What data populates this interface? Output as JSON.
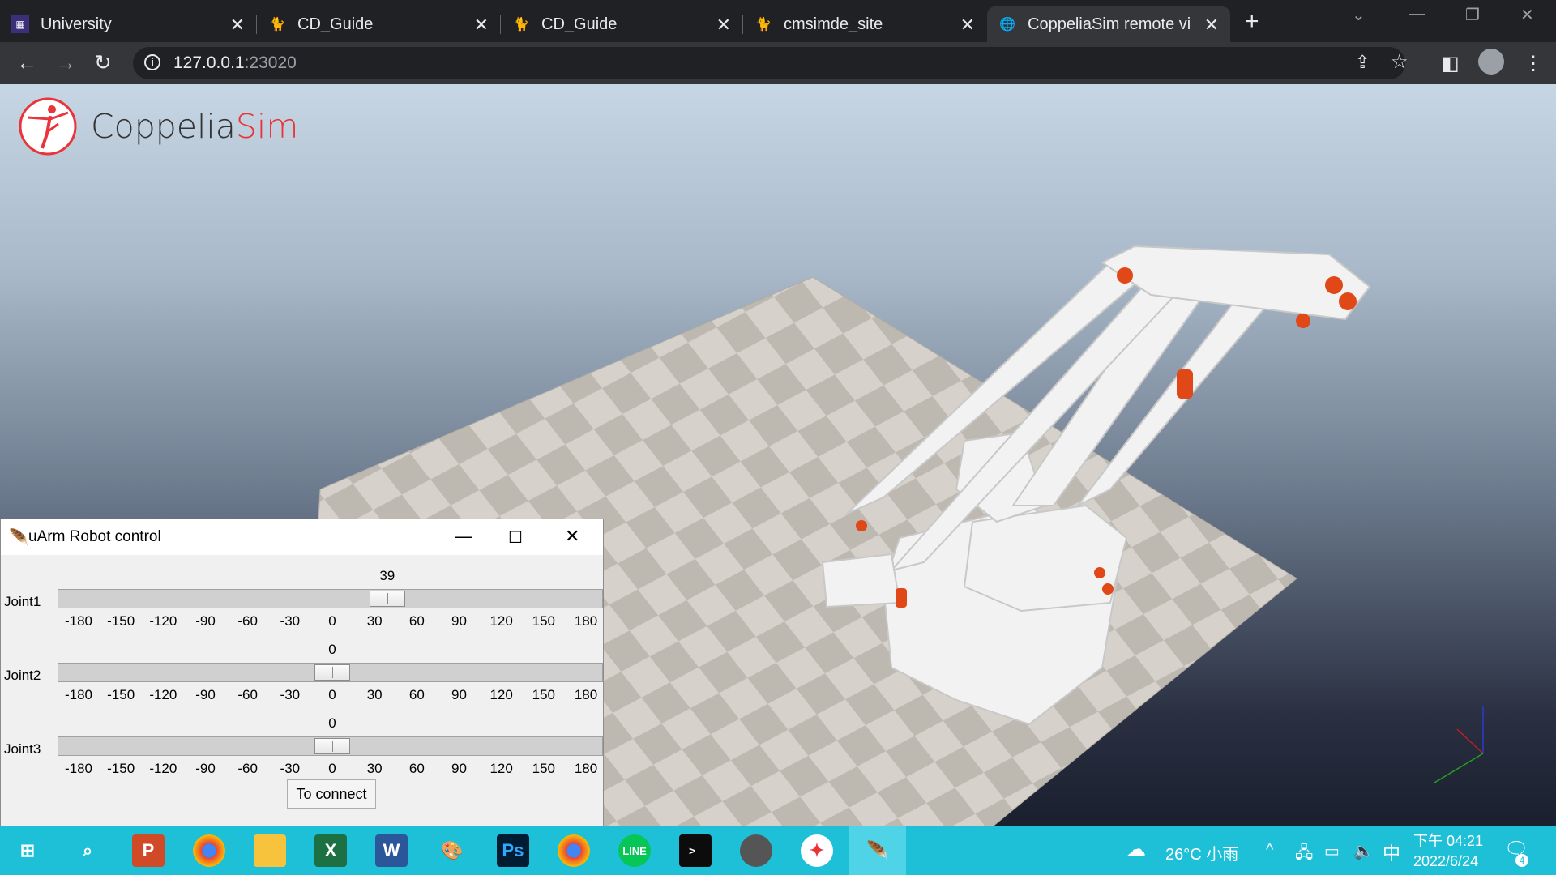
{
  "browser": {
    "tabs": [
      {
        "label": "University",
        "icon": "university-favicon"
      },
      {
        "label": "CD_Guide",
        "icon": "github-cat-favicon"
      },
      {
        "label": "CD_Guide",
        "icon": "github-cat-favicon"
      },
      {
        "label": "cmsimde_site",
        "icon": "github-cat-favicon"
      },
      {
        "label": "CoppeliaSim remote vie",
        "icon": "globe-favicon",
        "active": true
      }
    ],
    "address": {
      "host": "127.0.0.1",
      "port": ":23020"
    }
  },
  "viewer": {
    "logo": {
      "part1": "Coppelia",
      "part2": "Sim"
    }
  },
  "tk_window": {
    "title": "uArm Robot control",
    "scale_ticks": [
      "-180",
      "-150",
      "-120",
      "-90",
      "-60",
      "-30",
      "0",
      "30",
      "60",
      "90",
      "120",
      "150",
      "180"
    ],
    "joints": [
      {
        "label": "Joint1",
        "value": "39",
        "level": 39
      },
      {
        "label": "Joint2",
        "value": "0",
        "level": 0
      },
      {
        "label": "Joint3",
        "value": "0",
        "level": 0
      }
    ],
    "range": [
      -180,
      180
    ],
    "connect_label": "To connect"
  },
  "taskbar": {
    "weather": {
      "temp": "26°C",
      "desc": "小雨"
    },
    "ime": "中",
    "time": "下午 04:21",
    "date": "2022/6/24",
    "notifications": "4"
  },
  "colors": {
    "accent_red": "#e8343a",
    "taskbar": "#1ec0d8"
  }
}
